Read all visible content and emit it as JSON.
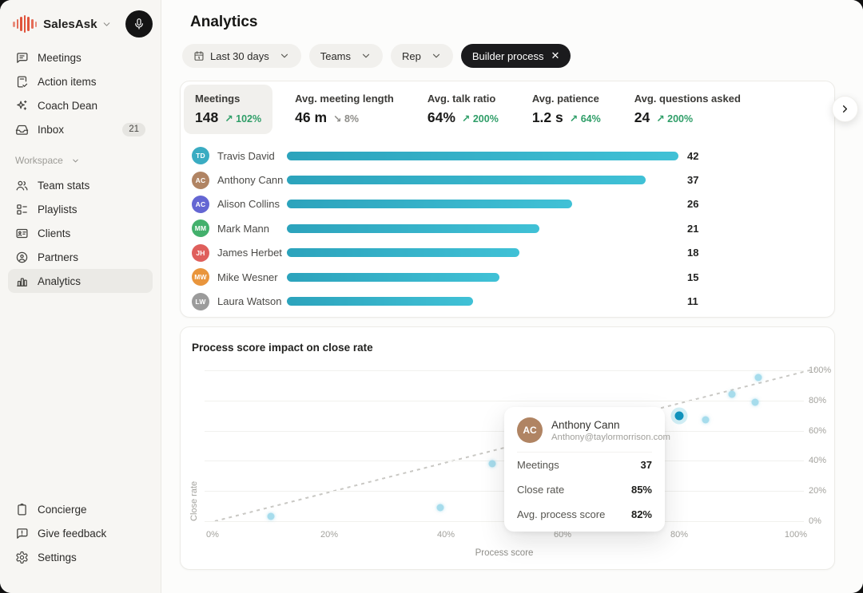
{
  "colors": {
    "brand_orange": "#e0543c",
    "accent_green": "#2f9e68",
    "bar_teal": "#35b1c9",
    "scatter_point": "#a6dcec",
    "scatter_highlight": "#1193bd"
  },
  "sidebar": {
    "brand": "SalesAsk",
    "mic_icon": "microphone-icon",
    "nav": [
      {
        "label": "Meetings",
        "icon": "chat-bubble"
      },
      {
        "label": "Action items",
        "icon": "note-check"
      },
      {
        "label": "Coach Dean",
        "icon": "sparkles"
      },
      {
        "label": "Inbox",
        "icon": "inbox-tray",
        "badge": "21"
      }
    ],
    "workspace_label": "Workspace",
    "workspace_nav": [
      {
        "label": "Team stats",
        "icon": "users"
      },
      {
        "label": "Playlists",
        "icon": "list-grid"
      },
      {
        "label": "Clients",
        "icon": "id-card"
      },
      {
        "label": "Partners",
        "icon": "person-badge"
      },
      {
        "label": "Analytics",
        "icon": "bar-chart",
        "active": true
      }
    ],
    "footer_nav": [
      {
        "label": "Concierge",
        "icon": "clipboard"
      },
      {
        "label": "Give feedback",
        "icon": "feedback-bubble"
      },
      {
        "label": "Settings",
        "icon": "gear"
      }
    ]
  },
  "header": {
    "title": "Analytics",
    "filters": [
      {
        "label": "Last 30 days",
        "icon": "calendar",
        "chevron": true
      },
      {
        "label": "Teams",
        "chevron": true
      },
      {
        "label": "Rep",
        "chevron": true
      },
      {
        "label": "Builder process",
        "dark": true,
        "close_icon": "✕"
      }
    ]
  },
  "stats": {
    "items": [
      {
        "label": "Meetings",
        "value": "148",
        "delta": "102%",
        "trend": "up",
        "selected": true
      },
      {
        "label": "Avg. meeting length",
        "value": "46 m",
        "delta": "8%",
        "trend": "down"
      },
      {
        "label": "Avg. talk ratio",
        "value": "64%",
        "delta": "200%",
        "trend": "up"
      },
      {
        "label": "Avg. patience",
        "value": "1.2 s",
        "delta": "64%",
        "trend": "up"
      },
      {
        "label": "Avg. questions asked",
        "value": "24",
        "delta": "200%",
        "trend": "up"
      }
    ]
  },
  "chart_data": [
    {
      "type": "bar",
      "title": "",
      "orientation": "horizontal",
      "categories": [
        "Travis David",
        "Anthony Cann",
        "Alison Collins",
        "Mark Mann",
        "James Herbet",
        "Mike Wesner",
        "Laura Watson"
      ],
      "values": [
        42,
        37,
        26,
        21,
        18,
        15,
        11
      ],
      "avatars": [
        {
          "initials": "TD",
          "color": "#3aacc2"
        },
        {
          "initials": "AC",
          "color": "#b08463"
        },
        {
          "initials": "AC",
          "color": "#6466d3"
        },
        {
          "initials": "MM",
          "color": "#43b06c"
        },
        {
          "initials": "JH",
          "color": "#df5f5c"
        },
        {
          "initials": "MW",
          "color": "#e9953c"
        },
        {
          "initials": "LW",
          "color": "#9b9b9b"
        }
      ],
      "bar_color": "#35b1c9",
      "value_labels": true
    },
    {
      "type": "scatter",
      "title": "Process score impact on close rate",
      "xlabel": "Process score",
      "ylabel": "Close rate",
      "xlim": [
        0,
        100
      ],
      "ylim": [
        0,
        100
      ],
      "x_ticks": [
        "0%",
        "20%",
        "40%",
        "60%",
        "80%",
        "100%"
      ],
      "y_ticks": [
        "0%",
        "20%",
        "40%",
        "60%",
        "80%",
        "100%"
      ],
      "grid": "horizontal",
      "y_axis_position": "right",
      "points": [
        {
          "x": 10,
          "y": 3
        },
        {
          "x": 39,
          "y": 9
        },
        {
          "x": 48,
          "y": 38
        },
        {
          "x": 80,
          "y": 70,
          "highlighted": true,
          "label": "Anthony Cann"
        },
        {
          "x": 84.5,
          "y": 67
        },
        {
          "x": 89,
          "y": 84
        },
        {
          "x": 93,
          "y": 79
        },
        {
          "x": 93.5,
          "y": 95
        }
      ],
      "trendline": {
        "from": [
          0,
          0
        ],
        "to": [
          103,
          100
        ],
        "style": "dashed"
      }
    }
  ],
  "tooltip": {
    "name": "Anthony Cann",
    "email": "Anthony@taylormorrison.com",
    "avatar_initials": "AC",
    "avatar_color": "#b08463",
    "rows": [
      {
        "label": "Meetings",
        "value": "37"
      },
      {
        "label": "Close rate",
        "value": "85%"
      },
      {
        "label": "Avg. process score",
        "value": "82%"
      }
    ]
  }
}
